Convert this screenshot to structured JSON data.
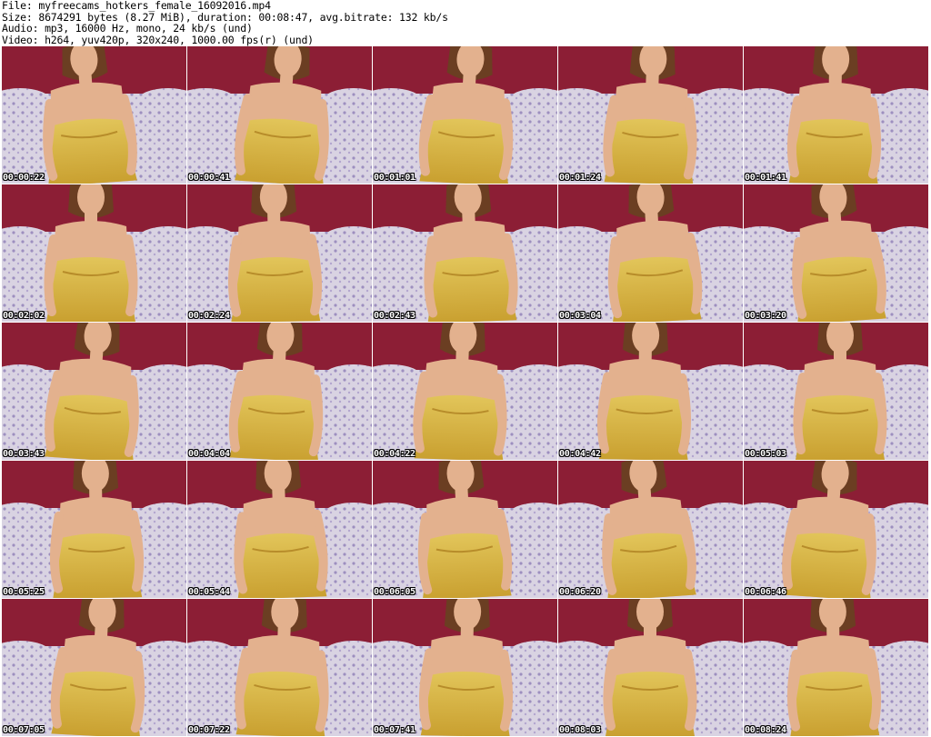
{
  "header": {
    "lines": [
      "File: myfreecams_hotkers_female_16092016.mp4",
      "Size: 8674291 bytes (8.27 MiB), duration: 00:08:47, avg.bitrate: 132 kb/s",
      "Audio: mp3, 16000 Hz, mono, 24 kb/s (und)",
      "Video: h264, yuv420p, 320x240, 1000.00 fps(r) (und)"
    ]
  },
  "thumbnails": [
    {
      "timestamp": "00:00:22"
    },
    {
      "timestamp": "00:00:41"
    },
    {
      "timestamp": "00:01:01"
    },
    {
      "timestamp": "00:01:24"
    },
    {
      "timestamp": "00:01:41"
    },
    {
      "timestamp": "00:02:02"
    },
    {
      "timestamp": "00:02:24"
    },
    {
      "timestamp": "00:02:43"
    },
    {
      "timestamp": "00:03:04"
    },
    {
      "timestamp": "00:03:20"
    },
    {
      "timestamp": "00:03:43"
    },
    {
      "timestamp": "00:04:04"
    },
    {
      "timestamp": "00:04:22"
    },
    {
      "timestamp": "00:04:42"
    },
    {
      "timestamp": "00:05:03"
    },
    {
      "timestamp": "00:05:25"
    },
    {
      "timestamp": "00:05:44"
    },
    {
      "timestamp": "00:06:05"
    },
    {
      "timestamp": "00:06:20"
    },
    {
      "timestamp": "00:06:46"
    },
    {
      "timestamp": "00:07:05"
    },
    {
      "timestamp": "00:07:22"
    },
    {
      "timestamp": "00:07:41"
    },
    {
      "timestamp": "00:08:03"
    },
    {
      "timestamp": "00:08:24"
    }
  ],
  "colors": {
    "wall": "#8c1e35",
    "couch": "#d9d3e2",
    "skin": "#e3b18e",
    "dress": "#d6b63c",
    "hair": "#6b3e22"
  }
}
